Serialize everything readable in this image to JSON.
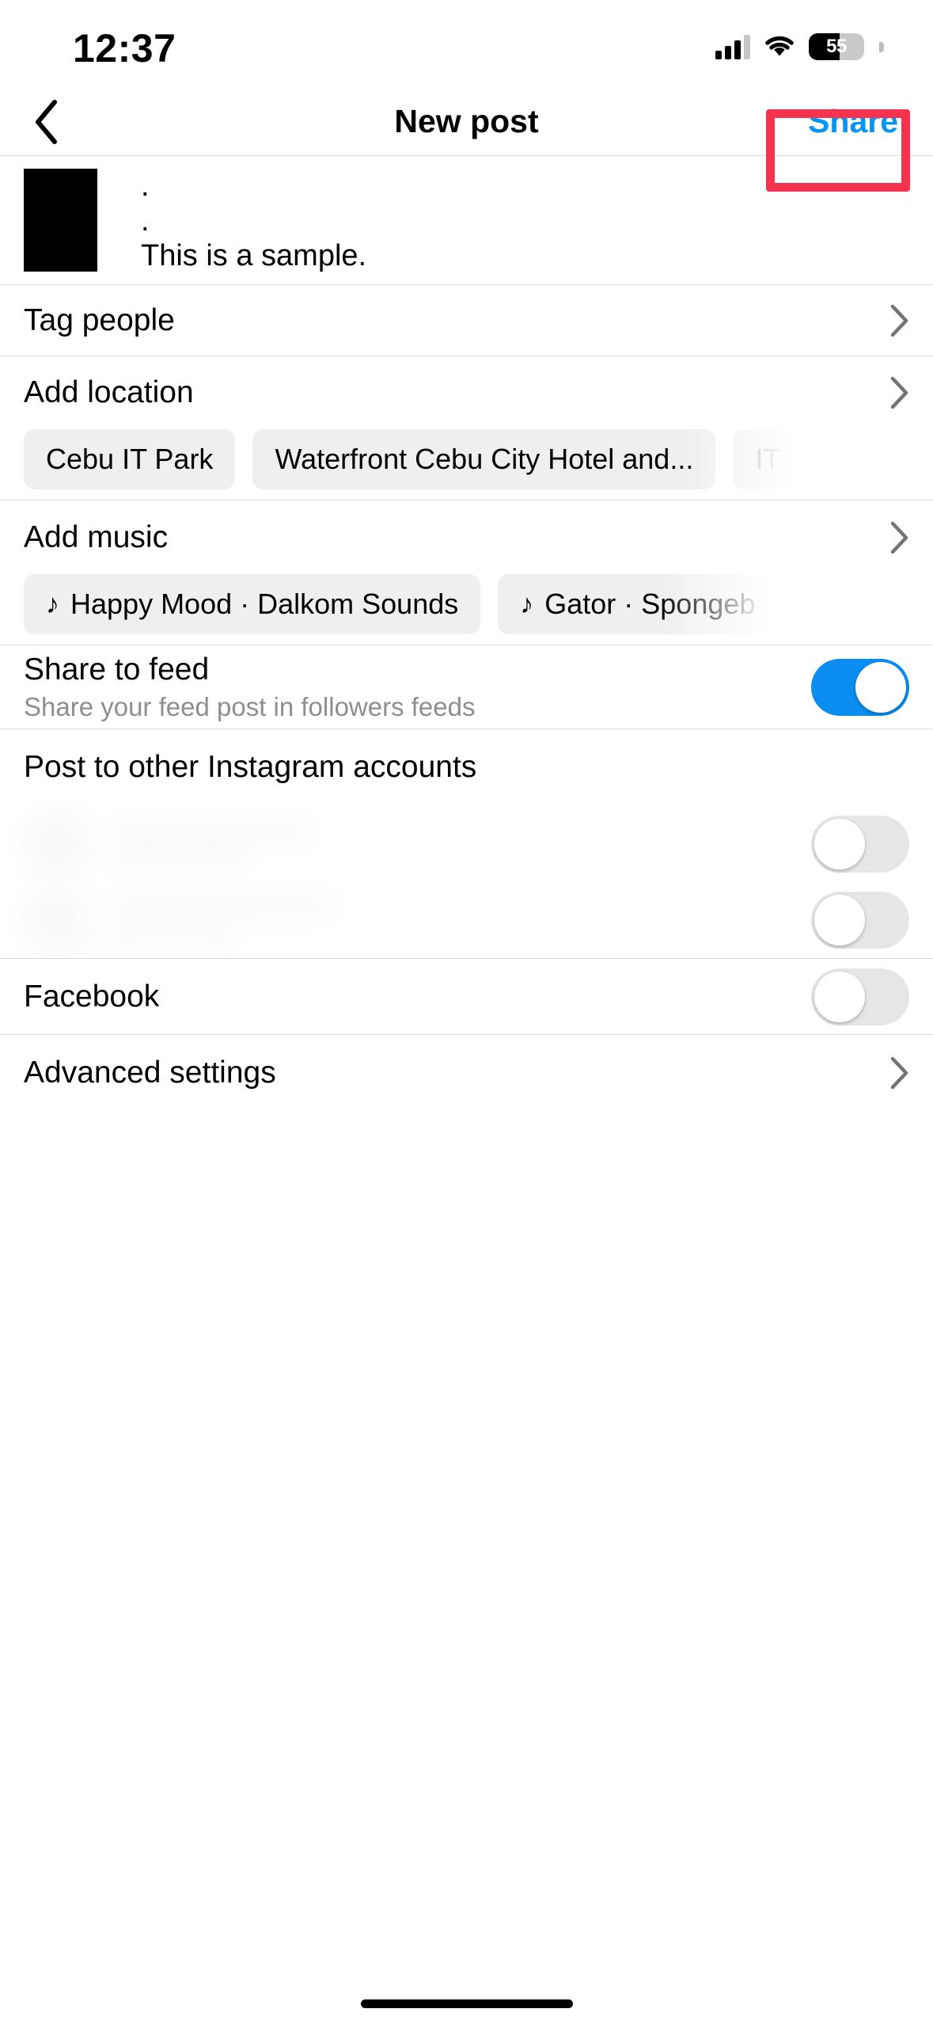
{
  "status_bar": {
    "time": "12:37",
    "battery_percent": "55",
    "battery_level": 55,
    "cellular_icon": "cellular-signal-icon",
    "wifi_icon": "wifi-icon",
    "battery_icon": "battery-icon"
  },
  "nav": {
    "back_icon": "back-chevron-icon",
    "title": "New post",
    "share_label": "Share",
    "share_color": "#0095f6",
    "highlight_color": "#f5334f"
  },
  "post": {
    "thumbnail": "post-thumbnail",
    "caption_lines": [
      ".",
      ".",
      ".",
      "This is a sample."
    ]
  },
  "rows": {
    "tag_people": {
      "label": "Tag people",
      "chevron": "chevron-right-icon"
    },
    "add_location": {
      "label": "Add location",
      "chevron": "chevron-right-icon"
    },
    "add_music": {
      "label": "Add music",
      "chevron": "chevron-right-icon"
    },
    "advanced_settings": {
      "label": "Advanced settings",
      "chevron": "chevron-right-icon"
    }
  },
  "location_suggestions": [
    {
      "label": "Cebu IT Park",
      "cut_off": false
    },
    {
      "label": "Waterfront Cebu City Hotel and...",
      "cut_off": false
    },
    {
      "label": "IT",
      "cut_off": true
    }
  ],
  "music_suggestions": [
    {
      "icon": "music-note-icon",
      "label": "Happy Mood · Dalkom Sounds",
      "cut_off": false
    },
    {
      "icon": "music-note-icon",
      "label": "Gator · Spongeb",
      "cut_off": true
    }
  ],
  "share_to_feed": {
    "title": "Share to feed",
    "subtitle": "Share your feed post in followers feeds",
    "toggle_on": true,
    "toggle_on_color": "#0a8cf0"
  },
  "other_accounts": {
    "heading": "Post to other Instagram accounts",
    "accounts": [
      {
        "toggle_on": false
      },
      {
        "toggle_on": false
      }
    ]
  },
  "facebook": {
    "label": "Facebook",
    "toggle_on": false
  },
  "home_indicator": "home-indicator"
}
